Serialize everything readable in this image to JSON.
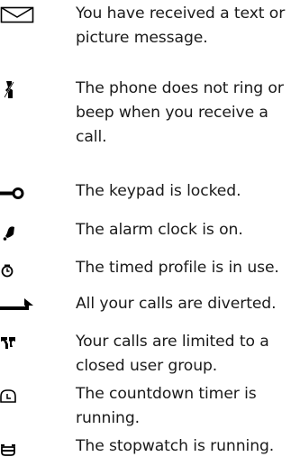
{
  "rows": [
    {
      "icon": "envelope-icon",
      "text": "You have received a text or picture message."
    },
    {
      "icon": "silent-ringer-icon",
      "text": "The phone does not ring or beep when you receive a call."
    },
    {
      "icon": "key-icon",
      "text": "The keypad is locked."
    },
    {
      "icon": "alarm-bell-icon",
      "text": "The alarm clock is on."
    },
    {
      "icon": "clock-icon",
      "text": "The timed profile is in use."
    },
    {
      "icon": "divert-arrow-icon",
      "text": "All your calls are diverted."
    },
    {
      "icon": "user-group-icon",
      "text": "Your calls are limited to a closed user group."
    },
    {
      "icon": "countdown-timer-icon",
      "text": "The countdown timer is running."
    },
    {
      "icon": "stopwatch-icon",
      "text": "The stopwatch is running."
    }
  ]
}
